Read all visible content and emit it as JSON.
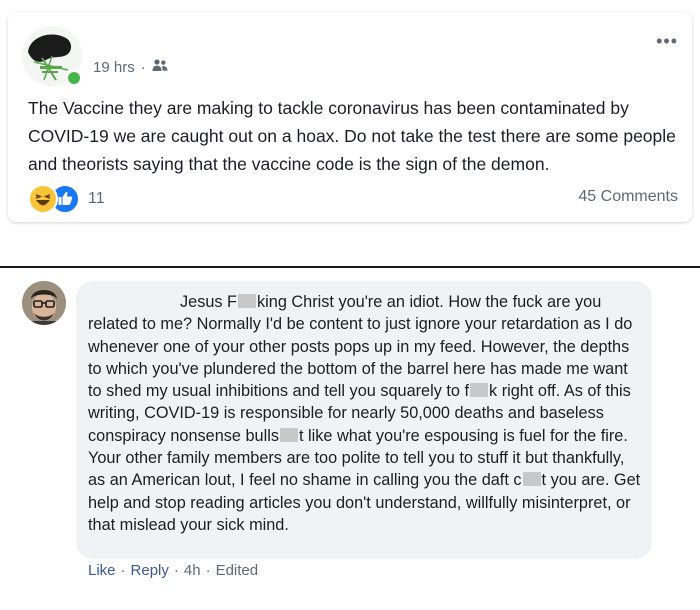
{
  "post": {
    "time": "19 hrs",
    "separator": "·",
    "text": "The Vaccine they are making to tackle coronavirus has been contaminated by COVID-19 we are caught out on a hoax. Do not take the test there are some people and theorists saying that the vaccine code is the sign of the demon.",
    "reaction_count": "11",
    "comments_count": "45 Comments",
    "icons": {
      "audience": "friends-icon",
      "more": "more-options-icon",
      "reactions": [
        "haha-reaction-icon",
        "like-reaction-icon"
      ]
    }
  },
  "comment": {
    "parts": {
      "p1": "Jesus F",
      "p2": "king Christ you're an idiot. How the fuck are you related to me? Normally I'd be content to just ignore your retardation as I do whenever one of your other posts pops up in my feed. However, the depths to which you've plundered the bottom of the barrel here has made me want to shed my usual inhibitions and tell you squarely to f",
      "p3": "k right off. As of this writing, COVID-19 is responsible for nearly 50,000 deaths and baseless conspiracy nonsense bulls",
      "p4": "t like what you're espousing is fuel for the fire. Your other family members are too polite to tell you to stuff it but thankfully, as an American lout, I feel no shame in calling you the daft c",
      "p5": "t you are. Get help and stop reading articles you don't understand, willfully misinterpret, or that mislead your sick mind."
    },
    "actions": {
      "like": "Like",
      "reply": "Reply",
      "time": "4h",
      "edited": "Edited",
      "separator": "·"
    }
  },
  "colors": {
    "link": "#385898",
    "muted": "#606770",
    "bubble": "#f0f2f5",
    "online": "#44b649",
    "like_blue": "#1877f2",
    "haha_yellow": "#f7c537"
  }
}
